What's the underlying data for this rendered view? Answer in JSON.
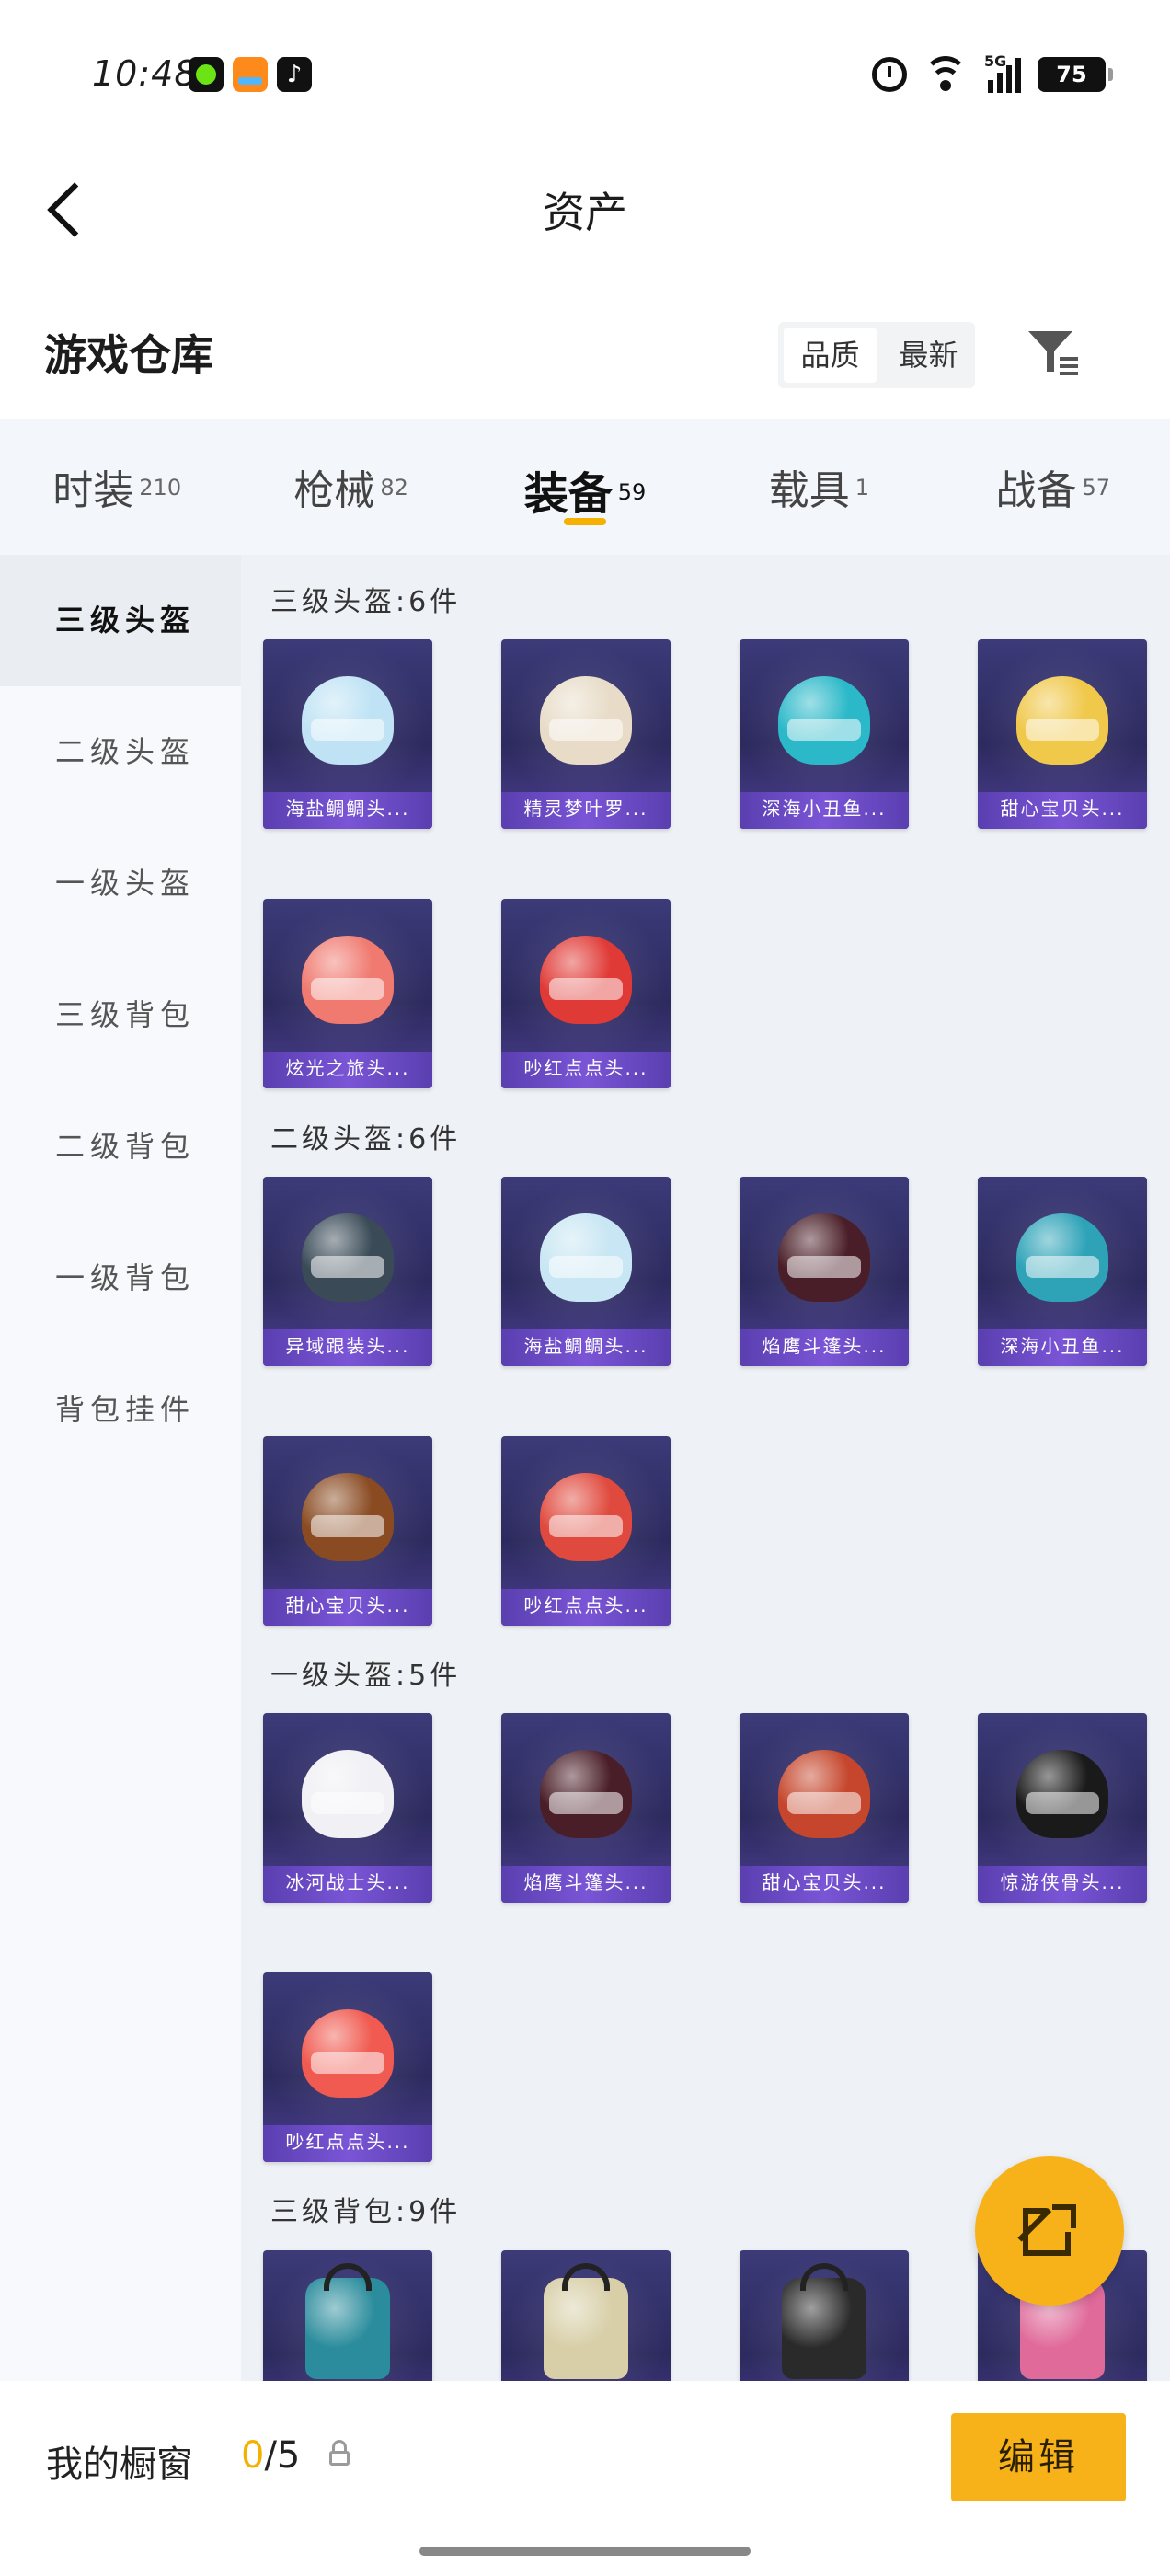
{
  "status_bar": {
    "time": "10:48",
    "network": "5G",
    "battery": "75"
  },
  "nav": {
    "title": "资产"
  },
  "warehouse": {
    "title": "游戏仓库",
    "sort_options": [
      "品质",
      "最新"
    ]
  },
  "tabs": [
    {
      "label": "时装",
      "count": "210"
    },
    {
      "label": "枪械",
      "count": "82"
    },
    {
      "label": "装备",
      "count": "59"
    },
    {
      "label": "载具",
      "count": "1"
    },
    {
      "label": "战备",
      "count": "57"
    }
  ],
  "sidebar": {
    "items": [
      "三级头盔",
      "二级头盔",
      "一级头盔",
      "三级背包",
      "二级背包",
      "一级背包",
      "背包挂件"
    ]
  },
  "sections": [
    {
      "title": "三级头盔:6件",
      "items": [
        "海盐鲷鲷头...",
        "精灵梦叶罗...",
        "深海小丑鱼...",
        "甜心宝贝头...",
        "炫光之旅头...",
        "吵红点点头..."
      ]
    },
    {
      "title": "二级头盔:6件",
      "items": [
        "异域跟装头...",
        "海盐鲷鲷头...",
        "焰鹰斗篷头...",
        "深海小丑鱼...",
        "甜心宝贝头...",
        "吵红点点头..."
      ]
    },
    {
      "title": "一级头盔:5件",
      "items": [
        "冰河战士头...",
        "焰鹰斗篷头...",
        "甜心宝贝头...",
        "惊游侠骨头...",
        "吵红点点头..."
      ]
    },
    {
      "title": "三级背包:9件",
      "items": [
        "",
        "",
        "",
        ""
      ]
    }
  ],
  "item_colors": {
    "s0": [
      "#bfe3f5",
      "#e8dcc8",
      "#2bb9c9",
      "#f0c84a",
      "#f07a70",
      "#e03a36"
    ],
    "s1": [
      "#3a4b57",
      "#c8e6f3",
      "#4a1e28",
      "#2ea3b8",
      "#8a4b22",
      "#e04a3e"
    ],
    "s2": [
      "#f0f0f5",
      "#4a1e28",
      "#c5462c",
      "#1a1a1a",
      "#f05a50"
    ],
    "s3": [
      "#2a8c9c",
      "#d8cfa8",
      "#2a2a2a",
      "#e06a9a"
    ]
  },
  "bottom": {
    "showcase_label": "我的橱窗",
    "current": "0",
    "total": "/5",
    "edit_label": "编辑"
  },
  "accent_color": "#f7b21a"
}
